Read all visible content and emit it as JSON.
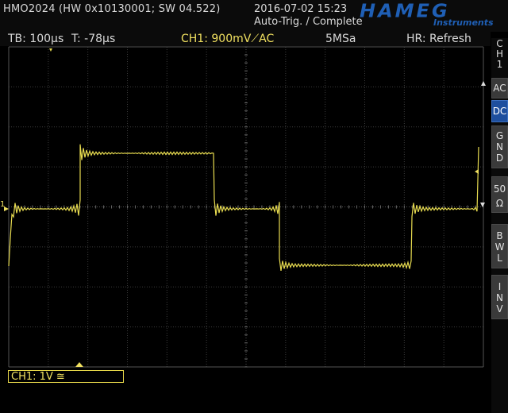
{
  "header": {
    "device": "HMO2024 (HW 0x10130001; SW 04.522)",
    "datetime": "2016-07-02 15:23",
    "status": "Auto-Trig. / Complete",
    "brand": "HAMEG",
    "brand_sub": "Instruments"
  },
  "infobar": {
    "timebase": "TB: 100µs",
    "trigger_time": "T: -78µs",
    "channel": "CH1: 900mV⟋AC",
    "sample_rate": "5MSa",
    "hr_mode": "HR: Refresh"
  },
  "channel_box": "CH1: 1V ≅",
  "sidebar": {
    "title": [
      "C",
      "H",
      "1"
    ],
    "buttons": [
      {
        "label": [
          "AC"
        ],
        "active": false
      },
      {
        "label": [
          "DC"
        ],
        "active": true
      },
      {
        "label": [
          "G",
          "N",
          "D"
        ],
        "active": false
      },
      {
        "label": [
          "50",
          "Ω"
        ],
        "active": false
      },
      {
        "label": [
          "B",
          "W",
          "L"
        ],
        "active": false
      },
      {
        "label": [
          "I",
          "N",
          "V"
        ],
        "active": false
      }
    ]
  },
  "markers": {
    "ch1_ground": "1"
  },
  "colors": {
    "trace": "#e8dc50",
    "grid": "#3c3c3c",
    "brand": "#1f5fb5",
    "active_button": "#1e4f9e"
  }
}
